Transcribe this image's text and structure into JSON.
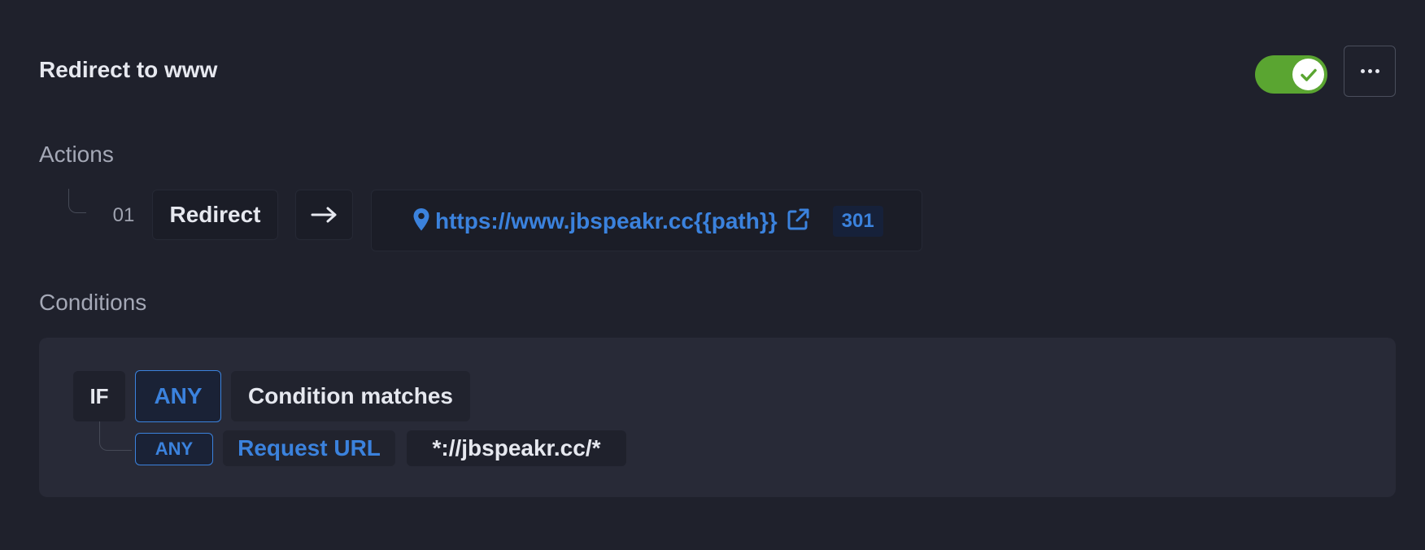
{
  "rule": {
    "title": "Redirect to www",
    "enabled": true,
    "toggle_color": "#5aa531",
    "more_icon": "more-horizontal-icon"
  },
  "actions": {
    "label": "Actions",
    "items": [
      {
        "number": "01",
        "type": "Redirect",
        "arrow_icon": "arrow-right-icon",
        "location_icon": "map-pin-icon",
        "target_url": "https://www.jbspeakr.cc{{path}}",
        "external_icon": "external-link-icon",
        "status_code": "301"
      }
    ]
  },
  "conditions": {
    "label": "Conditions",
    "if_keyword": "IF",
    "match_mode": "ANY",
    "header_text": "Condition matches",
    "items": [
      {
        "mode": "ANY",
        "field": "Request URL",
        "pattern": "*://jbspeakr.cc/*"
      }
    ]
  },
  "colors": {
    "background": "#1f212c",
    "accent_blue": "#3b82dd",
    "success_green": "#5aa531"
  }
}
